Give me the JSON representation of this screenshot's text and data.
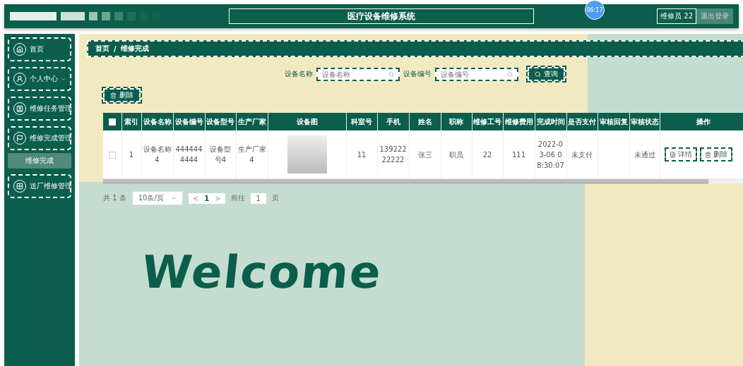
{
  "header": {
    "title": "医疗设备维修系统",
    "time": "06:17",
    "user": "维修员 22",
    "logout": "退出登录"
  },
  "sidebar": {
    "items": [
      {
        "kind": "link",
        "label": "首页"
      },
      {
        "kind": "menu",
        "label": "个人中心",
        "expanded": false
      },
      {
        "kind": "link",
        "label": "维修任务管理"
      },
      {
        "kind": "menu",
        "label": "维修完成管理",
        "expanded": true,
        "children": [
          {
            "label": "维修完成",
            "selected": true
          }
        ]
      },
      {
        "kind": "link",
        "label": "送厂维修管理"
      }
    ]
  },
  "breadcrumb": {
    "separator": "/",
    "items": [
      "首页",
      "维修完成"
    ]
  },
  "search": {
    "fields": [
      {
        "label": "设备名称",
        "placeholder": "设备名称"
      },
      {
        "label": "设备编号",
        "placeholder": "设备编号"
      }
    ],
    "button": "查询"
  },
  "delete_button": "删除",
  "table": {
    "columns": [
      "",
      "索引",
      "设备名称",
      "设备编号",
      "设备型号",
      "生产厂家",
      "设备图",
      "科室号",
      "手机",
      "姓名",
      "职称",
      "维修工号",
      "维修费用",
      "完成时间",
      "是否支付",
      "审核回复",
      "审核状态",
      "操作"
    ],
    "header_checked": false,
    "rows": [
      {
        "checked": false,
        "cells": [
          "",
          "1",
          "设备名称4",
          "4444444444",
          "设备型号4",
          "生产厂家4",
          null,
          "11",
          "13922222222",
          "张三",
          "职员",
          "22",
          "111",
          "2022-03-06 08:30:07",
          "未支付",
          "",
          "未通过"
        ],
        "actions": [
          "详情",
          "删除"
        ]
      }
    ]
  },
  "pagination": {
    "total": "共 1 条",
    "page_size": "10条/页",
    "prev": "<",
    "page": "1",
    "next": ">",
    "goto": "前往",
    "goto_value": "1",
    "goto_suffix": "页"
  },
  "welcome": "Welcome"
}
